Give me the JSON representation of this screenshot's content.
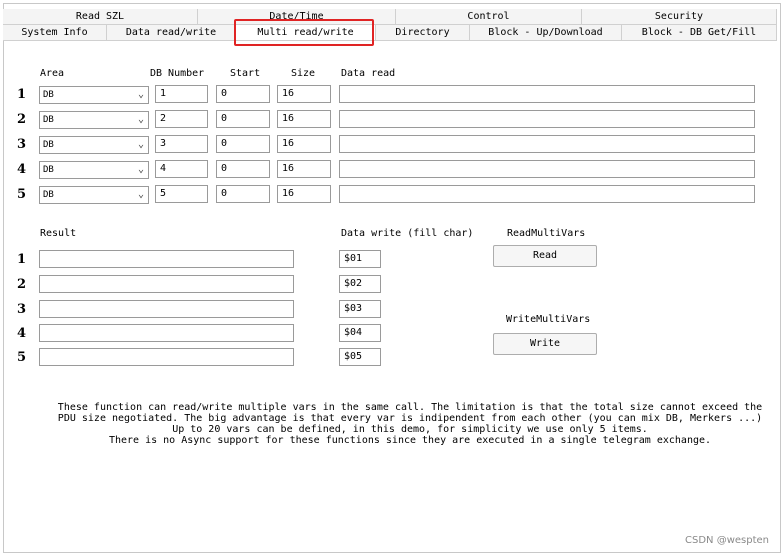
{
  "tabs_row1": [
    "Read SZL",
    "Date/Time",
    "Control",
    "Security"
  ],
  "tabs_row2": [
    "System Info",
    "Data read/write",
    "Multi read/write",
    "Directory",
    "Block - Up/Download",
    "Block - DB Get/Fill"
  ],
  "headers": {
    "area": "Area",
    "db_number": "DB Number",
    "start": "Start",
    "size": "Size",
    "data_read": "Data read",
    "result": "Result",
    "data_write": "Data write (fill char)",
    "read_multi": "ReadMultiVars",
    "write_multi": "WriteMultiVars"
  },
  "read_rows": [
    {
      "num": "1",
      "area": "DB",
      "db": "1",
      "start": "0",
      "size": "16",
      "data": ""
    },
    {
      "num": "2",
      "area": "DB",
      "db": "2",
      "start": "0",
      "size": "16",
      "data": ""
    },
    {
      "num": "3",
      "area": "DB",
      "db": "3",
      "start": "0",
      "size": "16",
      "data": ""
    },
    {
      "num": "4",
      "area": "DB",
      "db": "4",
      "start": "0",
      "size": "16",
      "data": ""
    },
    {
      "num": "5",
      "area": "DB",
      "db": "5",
      "start": "0",
      "size": "16",
      "data": ""
    }
  ],
  "result_rows": [
    {
      "num": "1",
      "result": "",
      "fill": "$01"
    },
    {
      "num": "2",
      "result": "",
      "fill": "$02"
    },
    {
      "num": "3",
      "result": "",
      "fill": "$03"
    },
    {
      "num": "4",
      "result": "",
      "fill": "$04"
    },
    {
      "num": "5",
      "result": "",
      "fill": "$05"
    }
  ],
  "buttons": {
    "read": "Read",
    "write": "Write"
  },
  "note_lines": [
    "These function can read/write multiple vars in the same call. The limitation is that the total size cannot exceed the",
    "PDU size negotiated. The big advantage is that every var is indipendent from each other (you can mix DB, Merkers ...)",
    "Up to 20 vars can be defined, in this demo, for simplicity we use only 5 items.",
    "There is no Async support for these functions since they are executed in a single telegram exchange."
  ],
  "watermark": "CSDN @wespten",
  "colors": {
    "highlight": "#e02424"
  }
}
